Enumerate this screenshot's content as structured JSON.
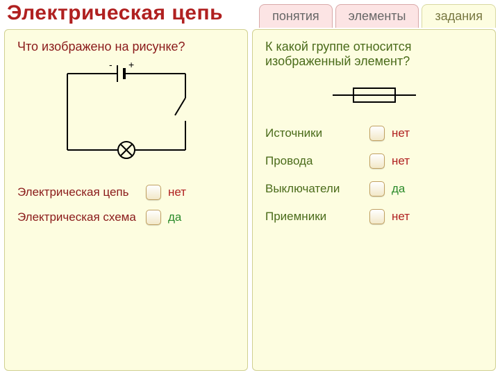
{
  "title": "Электрическая цепь",
  "tabs": {
    "t1": "понятия",
    "t2": "элементы",
    "t3": "задания"
  },
  "left": {
    "question": "Что изображено на рисунке?",
    "battery_minus": "-",
    "battery_plus": "+",
    "options": [
      {
        "label": "Электрическая цепь",
        "answer": "нет",
        "cls": "no"
      },
      {
        "label": "Электрическая схема",
        "answer": "да",
        "cls": "yes"
      }
    ]
  },
  "right": {
    "question": "К какой группе относится изображенный элемент?",
    "options": [
      {
        "label": "Источники",
        "answer": "нет",
        "cls": "no"
      },
      {
        "label": "Провода",
        "answer": "нет",
        "cls": "no"
      },
      {
        "label": "Выключатели",
        "answer": "да",
        "cls": "yes"
      },
      {
        "label": "Приемники",
        "answer": "нет",
        "cls": "no"
      }
    ]
  }
}
